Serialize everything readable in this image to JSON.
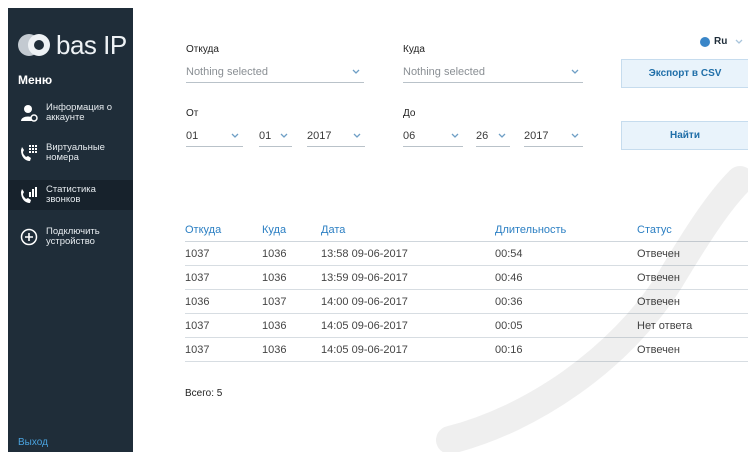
{
  "sidebar": {
    "logo_text": "bas IP",
    "menu_title": "Меню",
    "items": [
      {
        "label": "Информация о аккаунте",
        "icon": "user-settings-icon"
      },
      {
        "label": "Виртуальные номера",
        "icon": "phone-keypad-icon"
      },
      {
        "label": "Статистика звонков",
        "icon": "phone-stats-icon"
      },
      {
        "label": "Подключить устройство",
        "icon": "plus-circle-icon"
      }
    ],
    "logout_label": "Выход",
    "colors": {
      "background": "#1f2d39",
      "active": "#17222c"
    }
  },
  "language": {
    "label": "Ru",
    "icon": "globe-icon"
  },
  "filters": {
    "from_label": "Откуда",
    "from_value": "Nothing selected",
    "to_label": "Куда",
    "to_value": "Nothing selected",
    "date_from_label": "От",
    "date_from": {
      "day": "01",
      "month": "01",
      "year": "2017"
    },
    "date_to_label": "До",
    "date_to": {
      "day": "06",
      "month": "26",
      "year": "2017"
    }
  },
  "buttons": {
    "export_label": "Экспорт в CSV",
    "search_label": "Найти"
  },
  "table": {
    "headers": {
      "from": "Откуда",
      "to": "Куда",
      "date": "Дата",
      "duration": "Длительность",
      "status": "Статус"
    },
    "rows": [
      {
        "from": "1037",
        "to": "1036",
        "date": "13:58 09-06-2017",
        "duration": "00:54",
        "status": "Отвечен"
      },
      {
        "from": "1037",
        "to": "1036",
        "date": "13:59 09-06-2017",
        "duration": "00:46",
        "status": "Отвечен"
      },
      {
        "from": "1036",
        "to": "1037",
        "date": "14:00 09-06-2017",
        "duration": "00:36",
        "status": "Отвечен"
      },
      {
        "from": "1037",
        "to": "1036",
        "date": "14:05 09-06-2017",
        "duration": "00:05",
        "status": "Нет ответа"
      },
      {
        "from": "1037",
        "to": "1036",
        "date": "14:05 09-06-2017",
        "duration": "00:16",
        "status": "Отвечен"
      }
    ]
  },
  "total_text": "Всего: 5",
  "colors": {
    "accent": "#2b7fc3",
    "button_bg": "#e9f3fb"
  }
}
